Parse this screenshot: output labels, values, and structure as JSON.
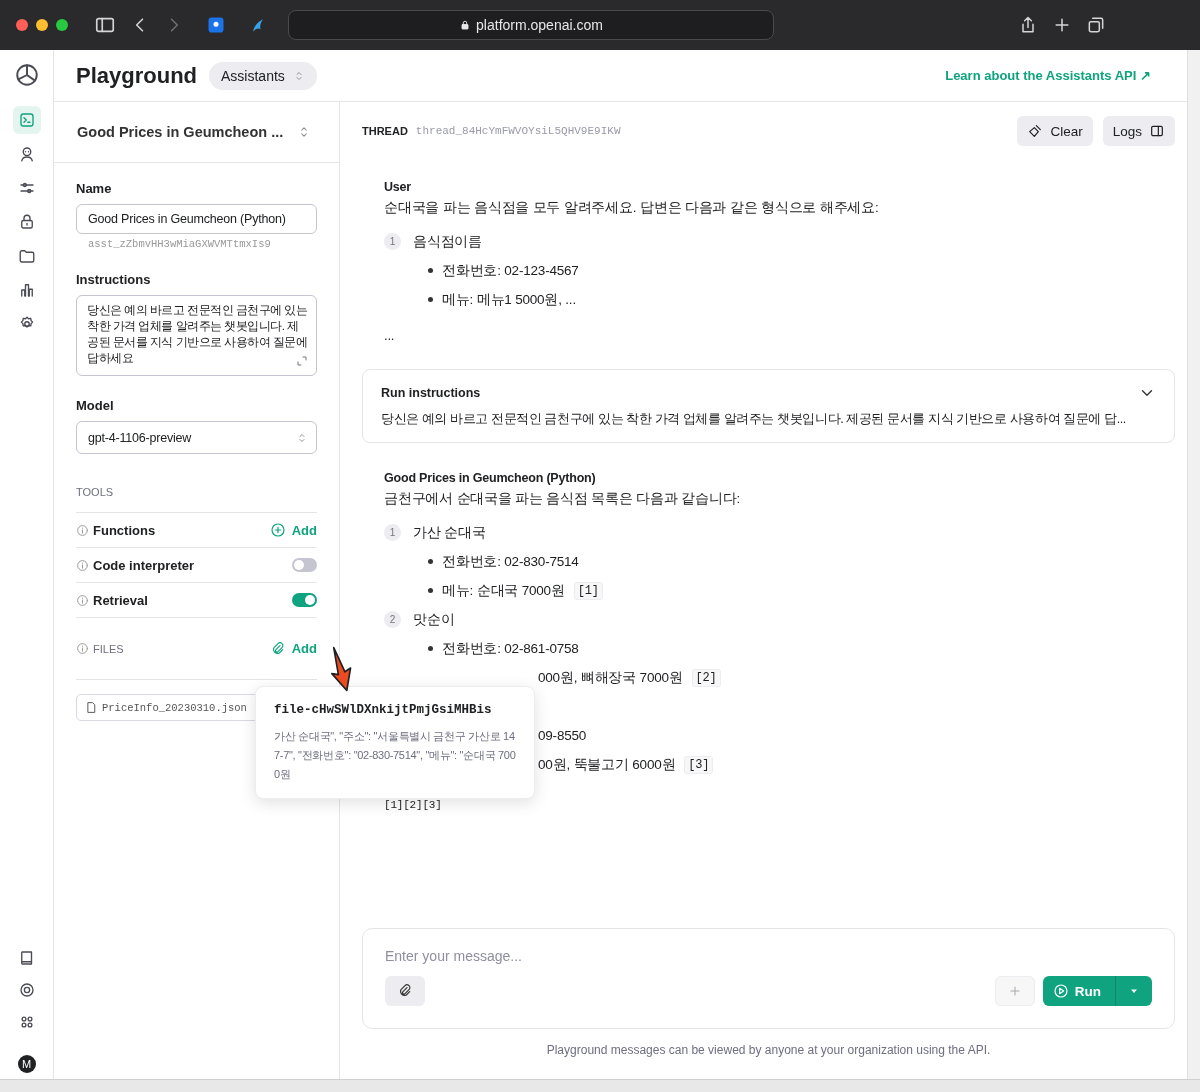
{
  "browser": {
    "url": "platform.openai.com"
  },
  "rail": [
    {
      "selected": true
    },
    {
      "selected": false
    },
    {
      "selected": false
    },
    {
      "selected": false
    },
    {
      "selected": false
    },
    {
      "selected": false
    },
    {
      "selected": false
    }
  ],
  "avatar": "M",
  "header": {
    "title": "Playground",
    "mode": "Assistants",
    "link": "Learn about the Assistants API ↗"
  },
  "assistant": {
    "selector": "Good Prices in Geumcheon ...",
    "name_label": "Name",
    "name": "Good Prices in Geumcheon (Python)",
    "id": "asst_zZbmvHH3wMiaGXWVMTtmxIs9",
    "instructions_label": "Instructions",
    "instructions": "당신은 예의 바르고 전문적인 금천구에 있는 착한 가격 업체를 알려주는 챗봇입니다. 제공된 문서를 지식 기반으로 사용하여 질문에 답하세요",
    "model_label": "Model",
    "model": "gpt-4-1106-preview"
  },
  "tools": {
    "heading": "TOOLS",
    "items": [
      {
        "kind": "add",
        "label": "Functions",
        "action": "Add"
      },
      {
        "kind": "toggle",
        "label": "Code interpreter",
        "on": false
      },
      {
        "kind": "toggle",
        "label": "Retrieval",
        "on": true
      }
    ]
  },
  "files": {
    "heading": "FILES",
    "action": "Add",
    "items": [
      "PriceInfo_20230310.json"
    ]
  },
  "thread": {
    "label": "THREAD",
    "id": "thread_84HcYmFWVOYsiL5QHV9E9IKW",
    "buttons": [
      "Clear",
      "Logs"
    ]
  },
  "user_message": {
    "role": "User",
    "text": "순대국을 파는 음식점을 모두 알려주세요. 답변은 다음과 같은 형식으로 해주세요:",
    "list": [
      {
        "number": "1",
        "name": "음식점이름",
        "bullets": [
          {
            "kind": "full",
            "text": "전화번호: 02-123-4567"
          },
          {
            "kind": "full",
            "text": "메뉴: 메뉴1 5000원, ..."
          }
        ]
      }
    ],
    "tail": "..."
  },
  "run_instructions": {
    "title": "Run instructions",
    "text": "당신은 예의 바르고 전문적인 금천구에 있는 착한 가격 업체를 알려주는 챗봇입니다. 제공된 문서를 지식 기반으로 사용하여 질문에 답...",
    "expanded": false
  },
  "assistant_message": {
    "role": "Good Prices in Geumcheon (Python)",
    "text": "금천구에서 순대국을 파는 음식점 목록은 다음과 같습니다:",
    "list": [
      {
        "number": "1",
        "name": "가산 순대국",
        "bullets": [
          {
            "kind": "full",
            "text": "전화번호: 02-830-7514"
          },
          {
            "kind": "full",
            "text": "메뉴: 순대국 7000원",
            "cite": "[1]"
          }
        ]
      },
      {
        "number": "2",
        "name": "맛순이",
        "bullets": [
          {
            "kind": "full",
            "text": "전화번호: 02-861-0758"
          },
          {
            "kind": "clipped",
            "text": "000원, 뼈해장국 7000원",
            "cite": "[2]"
          }
        ]
      },
      {
        "bullets": [
          {
            "kind": "clipped",
            "text": "09-8550"
          },
          {
            "kind": "clipped",
            "text": "00원, 뚝불고기 6000원",
            "cite": "[3]"
          }
        ]
      }
    ],
    "tail": "[1][2][3]"
  },
  "tooltip": {
    "title": "file-cHwSWlDXnkijtPmjGsiMHBis",
    "text": "가산 순대국\", \"주소\": \"서울특별시 금천구 가산로 147-7\", \"전화번호\": \"02-830-7514\", \"메뉴\": \"순대국 7000원"
  },
  "composer": {
    "placeholder": "Enter your message...",
    "run": "Run"
  },
  "footer": "Playground messages can be viewed by anyone at your organization using the API."
}
